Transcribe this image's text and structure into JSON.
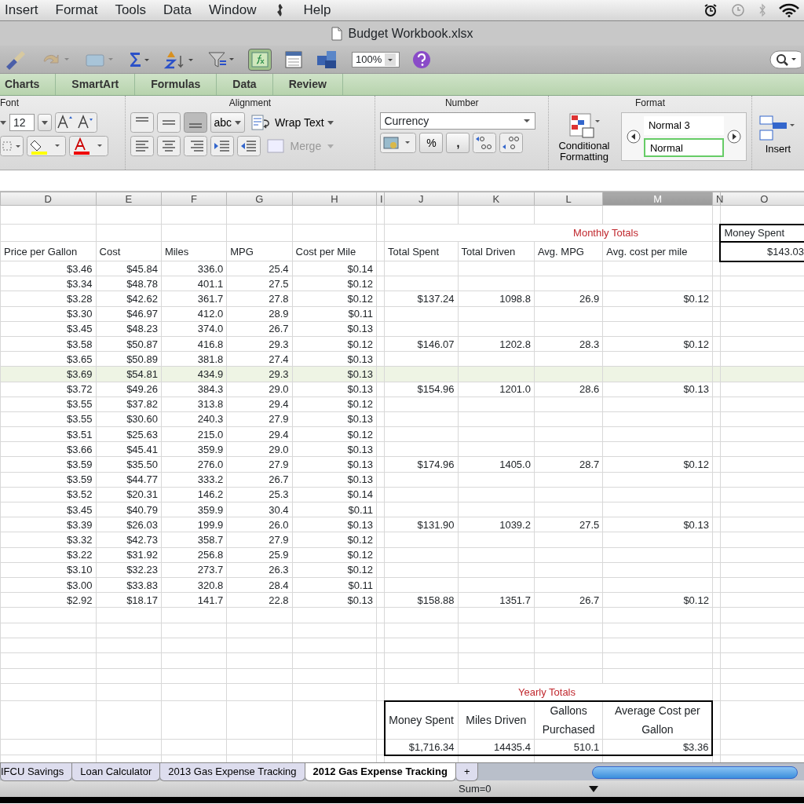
{
  "menu_bar": {
    "items": [
      "Insert",
      "Format",
      "Tools",
      "Data",
      "Window"
    ],
    "help": "Help"
  },
  "window": {
    "title": "Budget Workbook.xlsx"
  },
  "toolbar": {
    "zoom": "100%"
  },
  "ribbon_tabs": [
    {
      "label": "Charts",
      "selected": false
    },
    {
      "label": "SmartArt",
      "selected": false
    },
    {
      "label": "Formulas",
      "selected": false
    },
    {
      "label": "Data",
      "selected": false
    },
    {
      "label": "Review",
      "selected": false
    }
  ],
  "ribbon": {
    "font": {
      "title": "Font",
      "size": "12"
    },
    "alignment": {
      "title": "Alignment",
      "orientation": "abc",
      "wrap": "Wrap Text",
      "merge": "Merge",
      "merge_disabled": true
    },
    "number": {
      "title": "Number",
      "format": "Currency",
      "percent": "%",
      "comma": ","
    },
    "format": {
      "title": "Format",
      "conditional": "Conditional Formatting",
      "styles": [
        "Normal 3",
        "Normal"
      ],
      "insert": "Insert"
    }
  },
  "columns": [
    {
      "label": "D",
      "selected": false
    },
    {
      "label": "E",
      "selected": false
    },
    {
      "label": "F",
      "selected": false
    },
    {
      "label": "G",
      "selected": false
    },
    {
      "label": "H",
      "selected": false
    },
    {
      "label": "I",
      "selected": false
    },
    {
      "label": "J",
      "selected": false
    },
    {
      "label": "K",
      "selected": false
    },
    {
      "label": "L",
      "selected": false
    },
    {
      "label": "M",
      "selected": true
    },
    {
      "label": "N",
      "selected": false
    },
    {
      "label": "O",
      "selected": false
    }
  ],
  "monthly_title": "Monthly Totals",
  "headers": [
    "Price per Gallon",
    "Cost",
    "Miles",
    "MPG",
    "Cost per Mile"
  ],
  "monthly_headers": [
    "Total Spent",
    "Total Driven",
    "Avg. MPG",
    "Avg. cost per mile"
  ],
  "money_spent": {
    "label": "Money Spent",
    "value": "$143.03"
  },
  "rows": [
    {
      "cells": [
        "$3.46",
        "$45.84",
        "336.0",
        "25.4",
        "$0.14"
      ],
      "selected": false
    },
    {
      "cells": [
        "$3.34",
        "$48.78",
        "401.1",
        "27.5",
        "$0.12"
      ],
      "selected": false
    },
    {
      "cells": [
        "$3.28",
        "$42.62",
        "361.7",
        "27.8",
        "$0.12"
      ],
      "monthly": [
        "$137.24",
        "1098.8",
        "26.9",
        "$0.12"
      ],
      "selected": false
    },
    {
      "cells": [
        "$3.30",
        "$46.97",
        "412.0",
        "28.9",
        "$0.11"
      ],
      "selected": false
    },
    {
      "cells": [
        "$3.45",
        "$48.23",
        "374.0",
        "26.7",
        "$0.13"
      ],
      "selected": false
    },
    {
      "cells": [
        "$3.58",
        "$50.87",
        "416.8",
        "29.3",
        "$0.12"
      ],
      "monthly": [
        "$146.07",
        "1202.8",
        "28.3",
        "$0.12"
      ],
      "selected": false
    },
    {
      "cells": [
        "$3.65",
        "$50.89",
        "381.8",
        "27.4",
        "$0.13"
      ],
      "selected": false
    },
    {
      "cells": [
        "$3.69",
        "$54.81",
        "434.9",
        "29.3",
        "$0.13"
      ],
      "selected": true
    },
    {
      "cells": [
        "$3.72",
        "$49.26",
        "384.3",
        "29.0",
        "$0.13"
      ],
      "monthly": [
        "$154.96",
        "1201.0",
        "28.6",
        "$0.13"
      ],
      "selected": false
    },
    {
      "cells": [
        "$3.55",
        "$37.82",
        "313.8",
        "29.4",
        "$0.12"
      ],
      "selected": false
    },
    {
      "cells": [
        "$3.55",
        "$30.60",
        "240.3",
        "27.9",
        "$0.13"
      ],
      "selected": false
    },
    {
      "cells": [
        "$3.51",
        "$25.63",
        "215.0",
        "29.4",
        "$0.12"
      ],
      "selected": false
    },
    {
      "cells": [
        "$3.66",
        "$45.41",
        "359.9",
        "29.0",
        "$0.13"
      ],
      "selected": false
    },
    {
      "cells": [
        "$3.59",
        "$35.50",
        "276.0",
        "27.9",
        "$0.13"
      ],
      "monthly": [
        "$174.96",
        "1405.0",
        "28.7",
        "$0.12"
      ],
      "selected": false
    },
    {
      "cells": [
        "$3.59",
        "$44.77",
        "333.2",
        "26.7",
        "$0.13"
      ],
      "selected": false
    },
    {
      "cells": [
        "$3.52",
        "$20.31",
        "146.2",
        "25.3",
        "$0.14"
      ],
      "selected": false
    },
    {
      "cells": [
        "$3.45",
        "$40.79",
        "359.9",
        "30.4",
        "$0.11"
      ],
      "selected": false
    },
    {
      "cells": [
        "$3.39",
        "$26.03",
        "199.9",
        "26.0",
        "$0.13"
      ],
      "monthly": [
        "$131.90",
        "1039.2",
        "27.5",
        "$0.13"
      ],
      "selected": false
    },
    {
      "cells": [
        "$3.32",
        "$42.73",
        "358.7",
        "27.9",
        "$0.12"
      ],
      "selected": false
    },
    {
      "cells": [
        "$3.22",
        "$31.92",
        "256.8",
        "25.9",
        "$0.12"
      ],
      "selected": false
    },
    {
      "cells": [
        "$3.10",
        "$32.23",
        "273.7",
        "26.3",
        "$0.12"
      ],
      "selected": false
    },
    {
      "cells": [
        "$3.00",
        "$33.83",
        "320.8",
        "28.4",
        "$0.11"
      ],
      "selected": false
    },
    {
      "cells": [
        "$2.92",
        "$18.17",
        "141.7",
        "22.8",
        "$0.13"
      ],
      "monthly": [
        "$158.88",
        "1351.7",
        "26.7",
        "$0.12"
      ],
      "selected": false
    }
  ],
  "yearly": {
    "title": "Yearly Totals",
    "headers": [
      "Money Spent",
      "Miles Driven",
      "Gallons Purchased",
      "Average Cost per Gallon"
    ],
    "values": [
      "$1,716.34",
      "14435.4",
      "510.1",
      "$3.36"
    ]
  },
  "sheet_tabs": [
    {
      "label": "IFCU Savings",
      "selected": false
    },
    {
      "label": "Loan Calculator",
      "selected": false
    },
    {
      "label": "2013 Gas Expense Tracking",
      "selected": false
    },
    {
      "label": "2012 Gas Expense Tracking",
      "selected": true
    }
  ],
  "add_sheet": "+",
  "status_bar": {
    "sum": "Sum=0"
  }
}
